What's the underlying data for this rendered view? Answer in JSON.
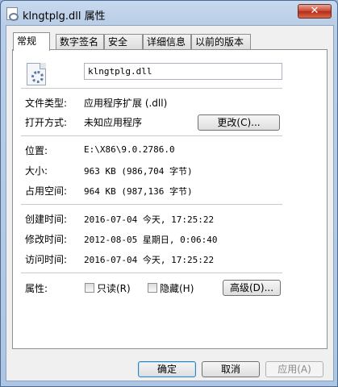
{
  "window": {
    "title": "klngtplg.dll 属性",
    "close_label": "✕"
  },
  "tabs": [
    {
      "label": "常规"
    },
    {
      "label": "数字签名"
    },
    {
      "label": "安全"
    },
    {
      "label": "详细信息"
    },
    {
      "label": "以前的版本"
    }
  ],
  "general": {
    "file_name": "klngtplg.dll",
    "file_type": {
      "label": "文件类型:",
      "value": "应用程序扩展 (.dll)"
    },
    "opens_with": {
      "label": "打开方式:",
      "value": "未知应用程序",
      "change_button": "更改(C)..."
    },
    "location": {
      "label": "位置:",
      "value": "E:\\X86\\9.0.2786.0"
    },
    "size": {
      "label": "大小:",
      "value": "963 KB (986,704 字节)"
    },
    "size_on_disk": {
      "label": "占用空间:",
      "value": "964 KB (987,136 字节)"
    },
    "created": {
      "label": "创建时间:",
      "value": "2016-07-04 今天, 17:25:22"
    },
    "modified": {
      "label": "修改时间:",
      "value": "2012-08-05 星期日, 0:06:40"
    },
    "accessed": {
      "label": "访问时间:",
      "value": "2016-07-04 今天, 17:25:22"
    },
    "attributes": {
      "label": "属性:",
      "readonly": {
        "label": "只读(R)",
        "checked": false
      },
      "hidden": {
        "label": "隐藏(H)",
        "checked": false
      },
      "advanced_button": "高级(D)..."
    }
  },
  "footer": {
    "ok": "确定",
    "cancel": "取消",
    "apply": "应用(A)"
  }
}
